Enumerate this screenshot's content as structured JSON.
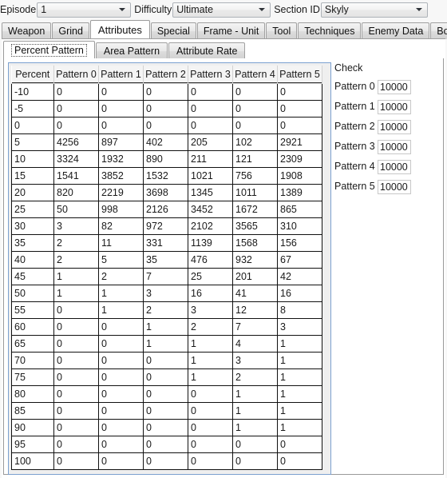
{
  "top_bar": {
    "episode": {
      "label": "Episode",
      "value": "1"
    },
    "difficulty": {
      "label": "Difficulty",
      "value": "Ultimate"
    },
    "section_id": {
      "label": "Section ID",
      "value": "Skyly"
    }
  },
  "tabs": [
    {
      "label": "Weapon",
      "selected": false
    },
    {
      "label": "Grind",
      "selected": false
    },
    {
      "label": "Attributes",
      "selected": true
    },
    {
      "label": "Special",
      "selected": false
    },
    {
      "label": "Frame - Unit",
      "selected": false
    },
    {
      "label": "Tool",
      "selected": false
    },
    {
      "label": "Techniques",
      "selected": false
    },
    {
      "label": "Enemy Data",
      "selected": false
    },
    {
      "label": "Box Data",
      "selected": false
    }
  ],
  "subtabs": [
    {
      "label": "Percent Pattern",
      "selected": true
    },
    {
      "label": "Area Pattern",
      "selected": false
    },
    {
      "label": "Attribute Rate",
      "selected": false
    }
  ],
  "grid": {
    "columns": [
      "Percent",
      "Pattern 0",
      "Pattern 1",
      "Pattern 2",
      "Pattern 3",
      "Pattern 4",
      "Pattern 5"
    ],
    "rows": [
      [
        "-10",
        "0",
        "0",
        "0",
        "0",
        "0",
        "0"
      ],
      [
        "-5",
        "0",
        "0",
        "0",
        "0",
        "0",
        "0"
      ],
      [
        "0",
        "0",
        "0",
        "0",
        "0",
        "0",
        "0"
      ],
      [
        "5",
        "4256",
        "897",
        "402",
        "205",
        "102",
        "2921"
      ],
      [
        "10",
        "3324",
        "1932",
        "890",
        "211",
        "121",
        "2309"
      ],
      [
        "15",
        "1541",
        "3852",
        "1532",
        "1021",
        "756",
        "1908"
      ],
      [
        "20",
        "820",
        "2219",
        "3698",
        "1345",
        "1011",
        "1389"
      ],
      [
        "25",
        "50",
        "998",
        "2126",
        "3452",
        "1672",
        "865"
      ],
      [
        "30",
        "3",
        "82",
        "972",
        "2102",
        "3565",
        "310"
      ],
      [
        "35",
        "2",
        "11",
        "331",
        "1139",
        "1568",
        "156"
      ],
      [
        "40",
        "2",
        "5",
        "35",
        "476",
        "932",
        "67"
      ],
      [
        "45",
        "1",
        "2",
        "7",
        "25",
        "201",
        "42"
      ],
      [
        "50",
        "1",
        "1",
        "3",
        "16",
        "41",
        "16"
      ],
      [
        "55",
        "0",
        "1",
        "2",
        "3",
        "12",
        "8"
      ],
      [
        "60",
        "0",
        "0",
        "1",
        "2",
        "7",
        "3"
      ],
      [
        "65",
        "0",
        "0",
        "1",
        "1",
        "4",
        "1"
      ],
      [
        "70",
        "0",
        "0",
        "0",
        "1",
        "3",
        "1"
      ],
      [
        "75",
        "0",
        "0",
        "0",
        "1",
        "2",
        "1"
      ],
      [
        "80",
        "0",
        "0",
        "0",
        "0",
        "1",
        "1"
      ],
      [
        "85",
        "0",
        "0",
        "0",
        "0",
        "1",
        "1"
      ],
      [
        "90",
        "0",
        "0",
        "0",
        "0",
        "1",
        "1"
      ],
      [
        "95",
        "0",
        "0",
        "0",
        "0",
        "0",
        "0"
      ],
      [
        "100",
        "0",
        "0",
        "0",
        "0",
        "0",
        "0"
      ]
    ]
  },
  "check": {
    "title": "Check",
    "rows": [
      {
        "label": "Pattern 0",
        "value": "10000"
      },
      {
        "label": "Pattern 1",
        "value": "10000"
      },
      {
        "label": "Pattern 2",
        "value": "10000"
      },
      {
        "label": "Pattern 3",
        "value": "10000"
      },
      {
        "label": "Pattern 4",
        "value": "10000"
      },
      {
        "label": "Pattern 5",
        "value": "10000"
      }
    ]
  }
}
